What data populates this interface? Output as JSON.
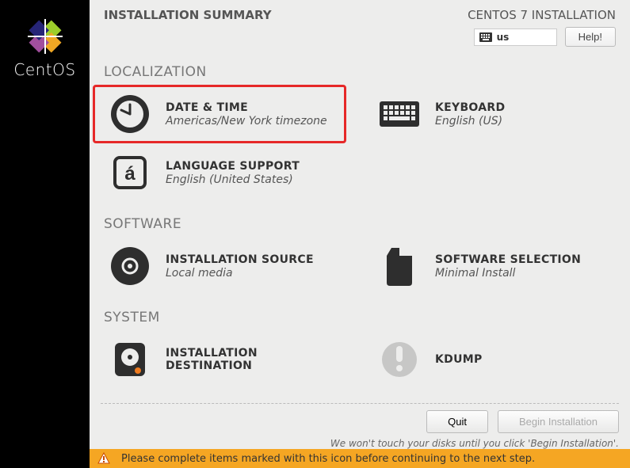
{
  "brand": "CentOS",
  "header": {
    "title": "INSTALLATION SUMMARY",
    "product": "CENTOS 7 INSTALLATION",
    "keyboard_layout": "us",
    "help_label": "Help!"
  },
  "sections": {
    "localization": {
      "title": "LOCALIZATION",
      "datetime": {
        "title": "DATE & TIME",
        "sub": "Americas/New York timezone"
      },
      "keyboard": {
        "title": "KEYBOARD",
        "sub": "English (US)"
      },
      "language": {
        "title": "LANGUAGE SUPPORT",
        "sub": "English (United States)"
      }
    },
    "software": {
      "title": "SOFTWARE",
      "source": {
        "title": "INSTALLATION SOURCE",
        "sub": "Local media"
      },
      "selection": {
        "title": "SOFTWARE SELECTION",
        "sub": "Minimal Install"
      }
    },
    "system": {
      "title": "SYSTEM",
      "destination": {
        "title": "INSTALLATION DESTINATION",
        "sub": ""
      },
      "kdump": {
        "title": "KDUMP",
        "sub": ""
      }
    }
  },
  "footer": {
    "quit": "Quit",
    "begin": "Begin Installation",
    "note": "We won't touch your disks until you click 'Begin Installation'."
  },
  "warning": "Please complete items marked with this icon before continuing to the next step."
}
